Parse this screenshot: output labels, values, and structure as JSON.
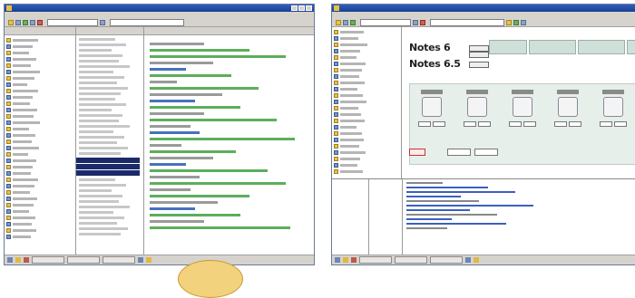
{
  "left_window": {
    "colors": {
      "titlebar": "#1c3f8f",
      "chrome": "#d6d3ce",
      "selection": "#1c2a6a"
    }
  },
  "right_window": {
    "notes": {
      "line1": "Notes 6",
      "line2": "Notes 6.5"
    },
    "colors": {
      "titlebar": "#1c3f8f",
      "panel": "#e6efe9"
    }
  }
}
